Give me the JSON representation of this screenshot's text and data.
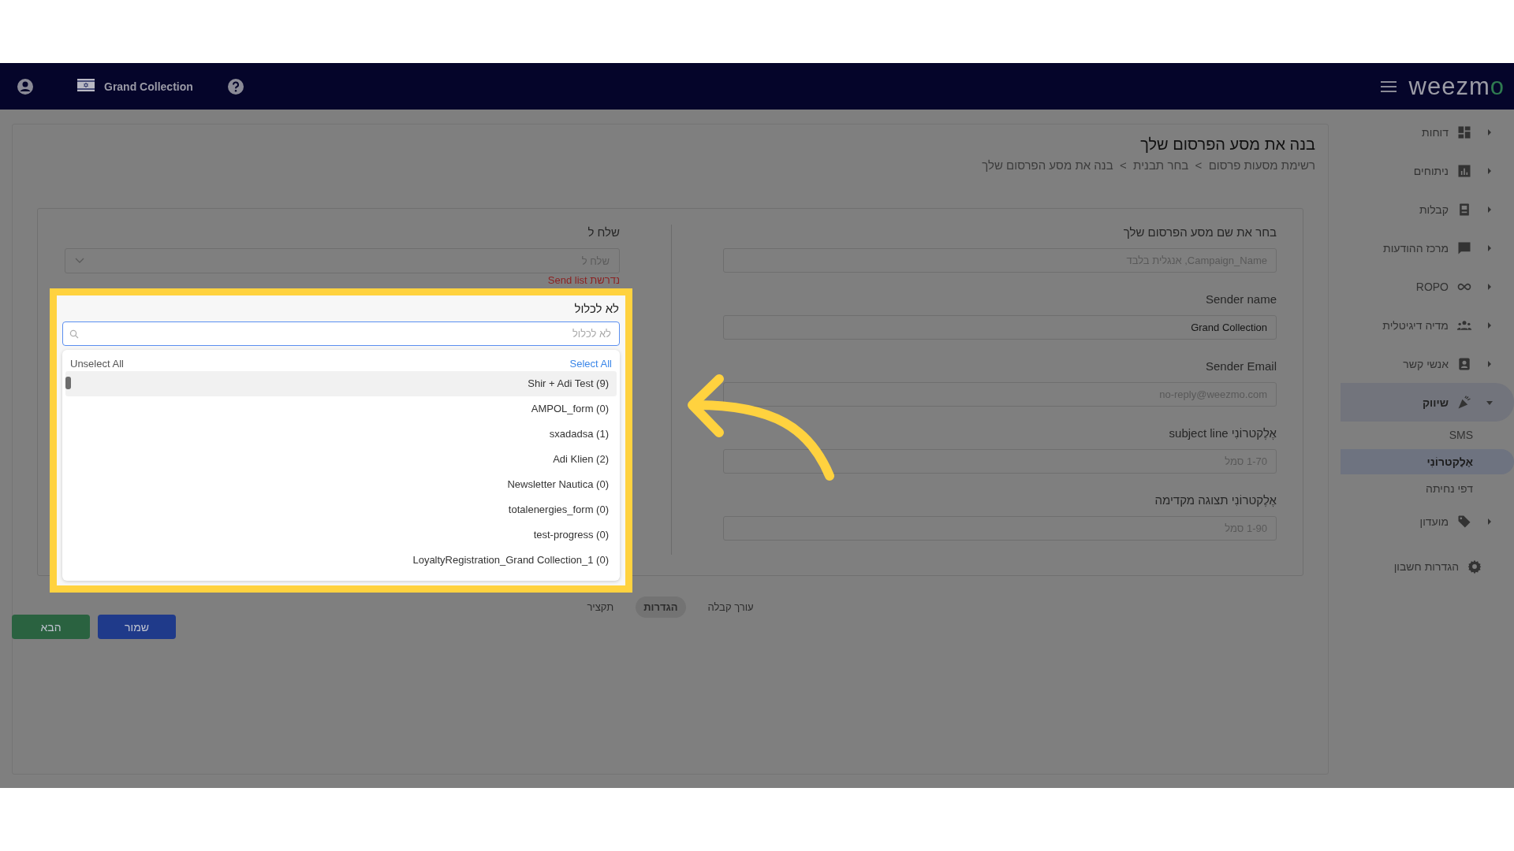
{
  "top_bar": {
    "store_name": "Grand Collection",
    "logo": "weezmo"
  },
  "sidebar": {
    "items": [
      {
        "label": "דוחות",
        "kind": "group",
        "expanded": false
      },
      {
        "label": "ניתוחים",
        "kind": "group",
        "expanded": false
      },
      {
        "label": "קבלות",
        "kind": "group",
        "expanded": false
      },
      {
        "label": "מרכז ההודעות",
        "kind": "group",
        "expanded": false
      },
      {
        "label": "ROPO",
        "kind": "group",
        "expanded": false
      },
      {
        "label": "מדיה דיגיטלית",
        "kind": "group",
        "expanded": false
      },
      {
        "label": "אנשי קשר",
        "kind": "group",
        "expanded": false
      },
      {
        "label": "שיווק",
        "kind": "group",
        "expanded": true,
        "children": [
          {
            "label": "SMS",
            "selected": false
          },
          {
            "label": "אֶלֶקטרוֹנִי",
            "selected": true
          },
          {
            "label": "דפי נחיתה",
            "selected": false
          }
        ]
      },
      {
        "label": "מועדון",
        "kind": "group",
        "expanded": false
      },
      {
        "label": "הגדרות חשבון",
        "kind": "link"
      }
    ]
  },
  "page": {
    "title": "בנה את מסע הפרסום שלך",
    "breadcrumb": "רשימת מסעות פרסום  >  בחר תבנית  >  בנה את מסע הפרסום שלך"
  },
  "form": {
    "fields": [
      {
        "label": "בחר את שם מסע הפרסום שלך",
        "placeholder": "Campaign_Name, אנגלית בלבד"
      },
      {
        "label": "Sender name",
        "value": "Grand Collection"
      },
      {
        "label": "Sender Email",
        "placeholder": "no-reply@weezmo.com"
      },
      {
        "label": "אֶלֶקטרוֹנִי subject line",
        "placeholder": "1-70 סמל"
      },
      {
        "label": "אֶלֶקטרוֹנִי תצוגה מקדימה",
        "placeholder": "1-90 סמל"
      }
    ],
    "send_to": {
      "label": "שלח ל",
      "placeholder": "שלח ל",
      "error": "נדרשת Send list"
    },
    "exclude_dropdown": {
      "title": "לא לכלול",
      "search_placeholder": "לא לכלול",
      "unselect_all": "Unselect All",
      "select_all": "Select All",
      "options": [
        {
          "label": "Shir + Adi Test (9)",
          "selected": true
        },
        {
          "label": "AMPOL_form (0)",
          "selected": false
        },
        {
          "label": "sxadadsa (1)",
          "selected": false
        },
        {
          "label": "Adi Klien (2)",
          "selected": false
        },
        {
          "label": "Newsletter Nautica (0)",
          "selected": false
        },
        {
          "label": "totalenergies_form (0)",
          "selected": false
        },
        {
          "label": "test-progress (0)",
          "selected": false
        },
        {
          "label": "LoyaltyRegistration_Grand Collection_1 (0)",
          "selected": false
        }
      ]
    }
  },
  "steps": [
    {
      "label": "עורך קבלה",
      "selected": false
    },
    {
      "label": "הגדרות",
      "selected": true
    },
    {
      "label": "תקציר",
      "selected": false
    }
  ],
  "buttons": [
    {
      "label": "שמור",
      "kind": "primary"
    },
    {
      "label": "הבא",
      "kind": "success"
    }
  ]
}
